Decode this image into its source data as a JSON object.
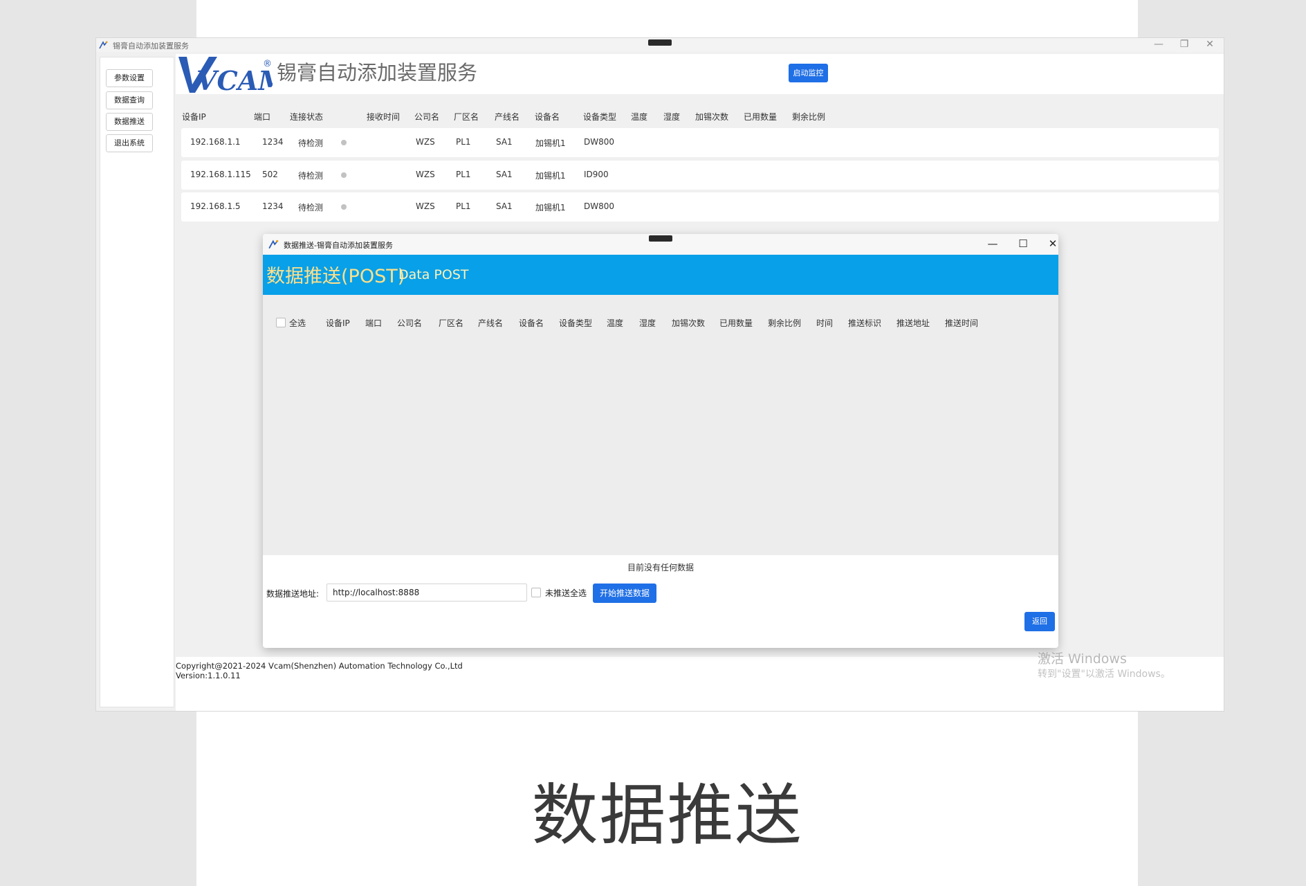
{
  "caption": "数据推送",
  "main_window": {
    "title": "锡膏自动添加装置服务",
    "controls": {
      "minimize": "—",
      "restore": "❐",
      "close": "✕"
    },
    "sidebar": [
      "参数设置",
      "数据查询",
      "数据推送",
      "退出系统"
    ],
    "logo_text": "VCAM",
    "logo_registered": "®",
    "heading": "锡膏自动添加装置服务",
    "start_button": "启动监控",
    "table": {
      "columns": [
        "设备IP",
        "端口",
        "连接状态",
        "接收时间",
        "公司名",
        "厂区名",
        "产线名",
        "设备名",
        "设备类型",
        "温度",
        "湿度",
        "加锡次数",
        "已用数量",
        "剩余比例"
      ],
      "rows": [
        {
          "ip": "192.168.1.1",
          "port": "1234",
          "status": "待检测",
          "company": "WZS",
          "factory": "PL1",
          "line": "SA1",
          "device": "加锡机1",
          "type": "DW800"
        },
        {
          "ip": "192.168.1.115",
          "port": "502",
          "status": "待检测",
          "company": "WZS",
          "factory": "PL1",
          "line": "SA1",
          "device": "加锡机1",
          "type": "ID900"
        },
        {
          "ip": "192.168.1.5",
          "port": "1234",
          "status": "待检测",
          "company": "WZS",
          "factory": "PL1",
          "line": "SA1",
          "device": "加锡机1",
          "type": "DW800"
        }
      ],
      "status_color": "#c2c2c2"
    },
    "footer": {
      "copyright": "Copyright@2021-2024 Vcam(Shenzhen) Automation Technology Co.,Ltd",
      "version": "Version:1.1.0.11"
    },
    "activation": {
      "line1": "激活 Windows",
      "line2": "转到\"设置\"以激活 Windows。"
    }
  },
  "dialog": {
    "title": "数据推送-锡膏自动添加装置服务",
    "controls": {
      "minimize": "—",
      "maximize": "☐",
      "close": "✕"
    },
    "banner_cn": "数据推送(POST)",
    "banner_en": "Data POST",
    "select_all": "全选",
    "columns": [
      "设备IP",
      "端口",
      "公司名",
      "厂区名",
      "产线名",
      "设备名",
      "设备类型",
      "温度",
      "湿度",
      "加锡次数",
      "已用数量",
      "剩余比例",
      "时间",
      "推送标识",
      "推送地址",
      "推送时间"
    ],
    "empty_message": "目前没有任何数据",
    "url_label": "数据推送地址:",
    "url_value": "http://localhost:8888",
    "unpushed_select_all": "未推送全选",
    "start_push_button": "开始推送数据",
    "back_button": "返回"
  },
  "colors": {
    "accent": "#1f6fe6",
    "banner": "#08a0e8",
    "banner_text": "#ffe08a"
  }
}
